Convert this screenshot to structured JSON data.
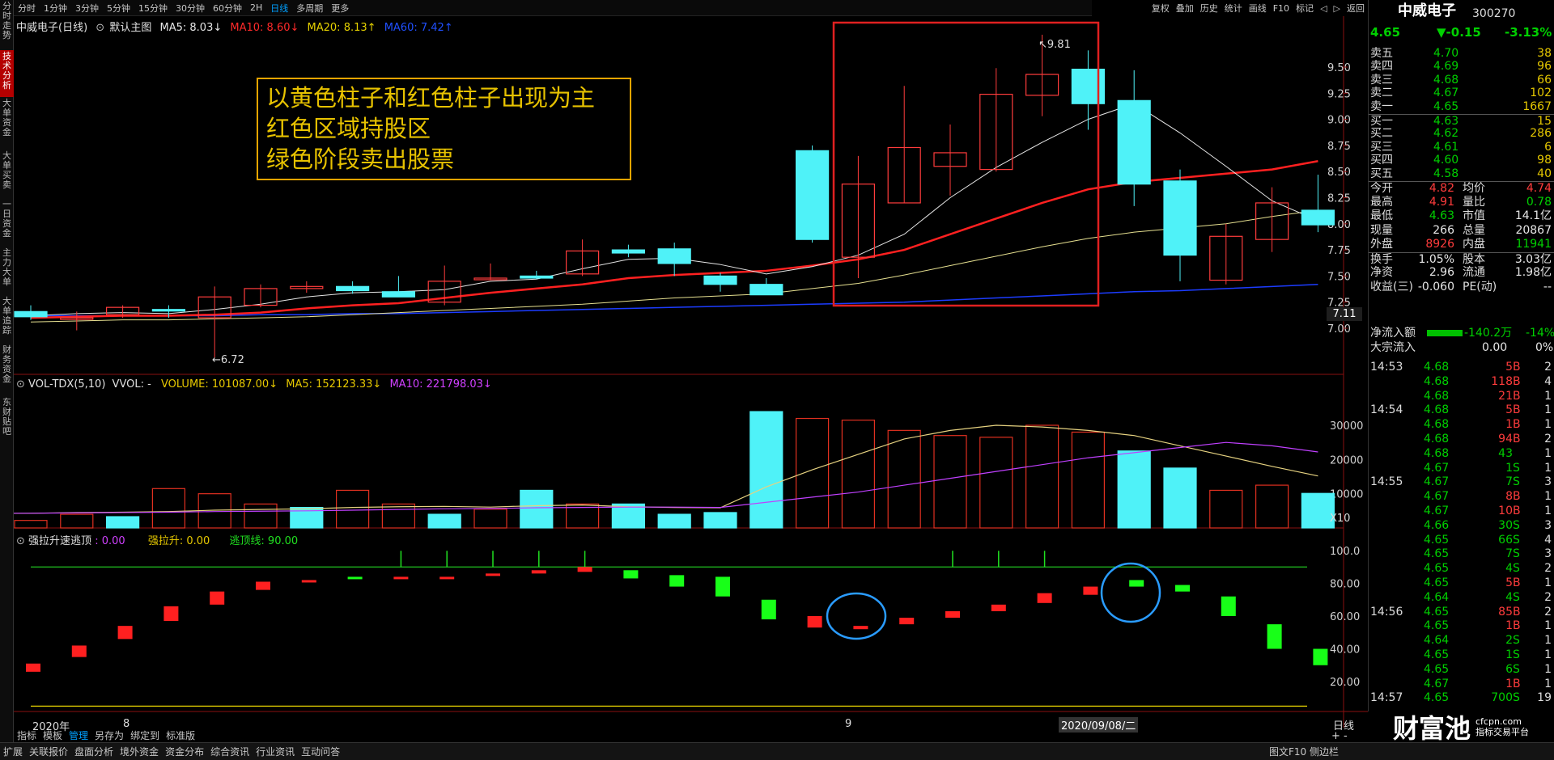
{
  "left_tabs": [
    "分时走势",
    "技术分析",
    "大单资金",
    "大单买卖",
    "一日资金",
    "主力大单",
    "大单追踪",
    "财务资金",
    "东财贴吧"
  ],
  "period_tabs": [
    "分时",
    "1分钟",
    "3分钟",
    "5分钟",
    "15分钟",
    "30分钟",
    "60分钟",
    "2H",
    "日线",
    "多周期",
    "更多"
  ],
  "period_selected": "日线",
  "tools": [
    "复权",
    "叠加",
    "历史",
    "统计",
    "画线",
    "F10",
    "标记",
    "◁",
    "▷",
    "返回"
  ],
  "main": {
    "title": "中威电子(日线)",
    "template": "默认主图",
    "ma5": "MA5: 8.03↓",
    "ma10": "MA10: 8.60↓",
    "ma20": "MA20: 8.13↑",
    "ma60": "MA60: 7.42↑"
  },
  "annotation": {
    "line1": "以黄色柱子和红色柱子出现为主",
    "line2": "红色区域持股区",
    "line3": "绿色阶段卖出股票"
  },
  "price_labels": {
    "high": "9.81",
    "low": "6.72",
    "current_tag": "7.11"
  },
  "volume": {
    "title": "VOL-TDX(5,10)",
    "vvol": "VVOL: -",
    "volume": "VOLUME: 101087.00↓",
    "ma5": "MA5: 152123.33↓",
    "ma10": "MA10: 221798.03↓",
    "unit": "X10"
  },
  "indicator": {
    "title": "强拉升速逃顶",
    "value1": ": 0.00",
    "value2_label": "强拉升: 0.00",
    "value3_label": "逃顶线: 90.00"
  },
  "date_axis": {
    "year": "2020年",
    "m8": "8",
    "m9": "9",
    "cursor": "2020/09/08/二",
    "period": "日线"
  },
  "template_tabs": [
    "指标",
    "模板",
    "管理",
    "另存为",
    "绑定到",
    "标准版"
  ],
  "template_selected": "管理",
  "stock": {
    "name": "中威电子",
    "code": "300270",
    "price": "4.65",
    "change": "▼-0.15",
    "pct": "-3.13%"
  },
  "order_book": [
    {
      "label": "卖五",
      "price": "4.70",
      "vol": "38"
    },
    {
      "label": "卖四",
      "price": "4.69",
      "vol": "96"
    },
    {
      "label": "卖三",
      "price": "4.68",
      "vol": "66"
    },
    {
      "label": "卖二",
      "price": "4.67",
      "vol": "102"
    },
    {
      "label": "卖一",
      "price": "4.65",
      "vol": "1667"
    },
    {
      "label": "买一",
      "price": "4.63",
      "vol": "15"
    },
    {
      "label": "买二",
      "price": "4.62",
      "vol": "286"
    },
    {
      "label": "买三",
      "price": "4.61",
      "vol": "6"
    },
    {
      "label": "买四",
      "price": "4.60",
      "vol": "98"
    },
    {
      "label": "买五",
      "price": "4.58",
      "vol": "40"
    }
  ],
  "quote": [
    {
      "l1": "今开",
      "v1": "4.82",
      "l2": "均价",
      "v2": "4.74"
    },
    {
      "l1": "最高",
      "v1": "4.91",
      "l2": "量比",
      "v2": "0.78"
    },
    {
      "l1": "最低",
      "v1": "4.63",
      "l2": "市值",
      "v2": "14.1亿"
    },
    {
      "l1": "现量",
      "v1": "266",
      "l2": "总量",
      "v2": "20867"
    },
    {
      "l1": "外盘",
      "v1": "8926",
      "l2": "内盘",
      "v2": "11941"
    },
    {
      "l1": "换手",
      "v1": "1.05%",
      "l2": "股本",
      "v2": "3.03亿"
    },
    {
      "l1": "净资",
      "v1": "2.96",
      "l2": "流通",
      "v2": "1.98亿"
    },
    {
      "l1": "收益(三)",
      "v1": "-0.060",
      "l2": "PE(动)",
      "v2": "--"
    }
  ],
  "flow": {
    "net_label": "净流入额",
    "net_val": "-140.2万",
    "net_pct": "-14%",
    "big_label": "大宗流入",
    "big_val": "0.00",
    "big_pct": "0%"
  },
  "ticks": [
    {
      "t": "14:53",
      "p": "4.68",
      "v": "5",
      "s": "B",
      "n": "2"
    },
    {
      "t": "",
      "p": "4.68",
      "v": "118",
      "s": "B",
      "n": "4"
    },
    {
      "t": "",
      "p": "4.68",
      "v": "21",
      "s": "B",
      "n": "1"
    },
    {
      "t": "14:54",
      "p": "4.68",
      "v": "5",
      "s": "B",
      "n": "1"
    },
    {
      "t": "",
      "p": "4.68",
      "v": "1",
      "s": "B",
      "n": "1"
    },
    {
      "t": "",
      "p": "4.68",
      "v": "94",
      "s": "B",
      "n": "2"
    },
    {
      "t": "",
      "p": "4.68",
      "v": "43",
      "s": "",
      "n": "1"
    },
    {
      "t": "",
      "p": "4.67",
      "v": "1",
      "s": "S",
      "n": "1"
    },
    {
      "t": "14:55",
      "p": "4.67",
      "v": "7",
      "s": "S",
      "n": "3"
    },
    {
      "t": "",
      "p": "4.67",
      "v": "8",
      "s": "B",
      "n": "1"
    },
    {
      "t": "",
      "p": "4.67",
      "v": "10",
      "s": "B",
      "n": "1"
    },
    {
      "t": "",
      "p": "4.66",
      "v": "30",
      "s": "S",
      "n": "3"
    },
    {
      "t": "",
      "p": "4.65",
      "v": "66",
      "s": "S",
      "n": "4"
    },
    {
      "t": "",
      "p": "4.65",
      "v": "7",
      "s": "S",
      "n": "3"
    },
    {
      "t": "",
      "p": "4.65",
      "v": "4",
      "s": "S",
      "n": "2"
    },
    {
      "t": "",
      "p": "4.65",
      "v": "5",
      "s": "B",
      "n": "1"
    },
    {
      "t": "",
      "p": "4.64",
      "v": "4",
      "s": "S",
      "n": "2"
    },
    {
      "t": "14:56",
      "p": "4.65",
      "v": "85",
      "s": "B",
      "n": "2"
    },
    {
      "t": "",
      "p": "4.65",
      "v": "1",
      "s": "B",
      "n": "1"
    },
    {
      "t": "",
      "p": "4.64",
      "v": "2",
      "s": "S",
      "n": "1"
    },
    {
      "t": "",
      "p": "4.65",
      "v": "1",
      "s": "S",
      "n": "1"
    },
    {
      "t": "",
      "p": "4.65",
      "v": "6",
      "s": "S",
      "n": "1"
    },
    {
      "t": "",
      "p": "4.67",
      "v": "1",
      "s": "B",
      "n": "1"
    },
    {
      "t": "14:57",
      "p": "4.65",
      "v": "700",
      "s": "S",
      "n": "19"
    }
  ],
  "bottom_tabs": [
    "扩展",
    "关联报价",
    "盘面分析",
    "境外资金",
    "资金分布",
    "综合资讯",
    "行业资讯",
    "互动问答"
  ],
  "bottom_right": "图文F10 侧边栏",
  "logo": {
    "main": "财富池",
    "sub1": "cfcpn.com",
    "sub2": "指标交易平台"
  },
  "chart_data": [
    {
      "type": "candlestick",
      "title": "中威电子(日线)",
      "y_ticks": [
        "9.50",
        "9.25",
        "9.00",
        "8.75",
        "8.50",
        "8.25",
        "8.00",
        "7.75",
        "7.50",
        "7.25",
        "7.00"
      ],
      "ylim": [
        6.72,
        9.85
      ],
      "ohlc": [
        [
          7.16,
          7.22,
          7.08,
          7.11
        ],
        [
          7.1,
          7.16,
          6.98,
          7.1
        ],
        [
          7.13,
          7.22,
          7.1,
          7.2
        ],
        [
          7.18,
          7.22,
          7.1,
          7.17
        ],
        [
          7.1,
          7.4,
          6.72,
          7.3
        ],
        [
          7.22,
          7.42,
          7.2,
          7.38
        ],
        [
          7.38,
          7.45,
          7.34,
          7.4
        ],
        [
          7.4,
          7.45,
          7.33,
          7.36
        ],
        [
          7.35,
          7.5,
          7.33,
          7.3
        ],
        [
          7.25,
          7.6,
          7.22,
          7.45
        ],
        [
          7.48,
          7.62,
          7.46,
          7.48
        ],
        [
          7.5,
          7.55,
          7.47,
          7.48
        ],
        [
          7.52,
          7.85,
          7.5,
          7.74
        ],
        [
          7.75,
          7.8,
          7.68,
          7.72
        ],
        [
          7.76,
          7.82,
          7.5,
          7.62
        ],
        [
          7.5,
          7.53,
          7.35,
          7.42
        ],
        [
          7.42,
          7.48,
          7.35,
          7.32
        ],
        [
          8.7,
          8.75,
          7.82,
          7.85
        ],
        [
          7.68,
          8.65,
          7.48,
          8.38
        ],
        [
          8.2,
          9.32,
          8.2,
          8.73
        ],
        [
          8.55,
          8.95,
          8.27,
          8.68
        ],
        [
          8.52,
          9.49,
          8.5,
          9.24
        ],
        [
          9.23,
          9.81,
          9.03,
          9.43
        ],
        [
          9.48,
          9.66,
          8.9,
          9.15
        ],
        [
          9.18,
          9.47,
          8.17,
          8.38
        ],
        [
          8.41,
          8.52,
          7.45,
          7.7
        ],
        [
          7.46,
          8.0,
          7.42,
          7.88
        ],
        [
          7.85,
          8.35,
          7.73,
          8.2
        ],
        [
          8.13,
          8.47,
          7.92,
          7.99
        ]
      ],
      "ma5": [
        7.12,
        7.14,
        7.15,
        7.14,
        7.18,
        7.23,
        7.3,
        7.34,
        7.35,
        7.37,
        7.45,
        7.47,
        7.57,
        7.66,
        7.67,
        7.61,
        7.52,
        7.59,
        7.7,
        7.9,
        8.25,
        8.54,
        8.78,
        9.0,
        9.15,
        8.87,
        8.55,
        8.22,
        8.03
      ],
      "ma10": [
        7.1,
        7.11,
        7.12,
        7.12,
        7.13,
        7.15,
        7.19,
        7.22,
        7.24,
        7.29,
        7.34,
        7.38,
        7.42,
        7.48,
        7.51,
        7.53,
        7.55,
        7.6,
        7.66,
        7.75,
        7.9,
        8.05,
        8.2,
        8.33,
        8.4,
        8.44,
        8.48,
        8.52,
        8.6
      ],
      "ma20": [
        7.06,
        7.07,
        7.08,
        7.08,
        7.09,
        7.1,
        7.11,
        7.13,
        7.15,
        7.17,
        7.19,
        7.21,
        7.23,
        7.26,
        7.29,
        7.31,
        7.33,
        7.38,
        7.43,
        7.51,
        7.6,
        7.69,
        7.78,
        7.86,
        7.92,
        7.96,
        8.0,
        8.07,
        8.13
      ],
      "ma60": [
        7.12,
        7.12,
        7.12,
        7.12,
        7.12,
        7.13,
        7.13,
        7.14,
        7.14,
        7.15,
        7.16,
        7.17,
        7.18,
        7.19,
        7.2,
        7.21,
        7.22,
        7.23,
        7.24,
        7.25,
        7.27,
        7.29,
        7.31,
        7.33,
        7.35,
        7.36,
        7.38,
        7.4,
        7.42
      ]
    },
    {
      "type": "bar",
      "title": "VOL-TDX(5,10)",
      "y_ticks": [
        "30000",
        "20000",
        "10000"
      ],
      "ylim": [
        0,
        36000
      ],
      "values": [
        3000,
        2200,
        4000,
        3300,
        11500,
        10000,
        7000,
        6000,
        11000,
        7000,
        4000,
        5500,
        11000,
        7000,
        7000,
        4000,
        4500,
        34000,
        32000,
        31500,
        28500,
        27000,
        26500,
        30000,
        28000,
        22500,
        17500,
        11000,
        12500,
        10100
      ],
      "ma5": [
        4200,
        4300,
        4500,
        4600,
        4800,
        5200,
        5400,
        5600,
        6000,
        6200,
        6300,
        6100,
        6500,
        6700,
        6200,
        6000,
        5900,
        12000,
        17000,
        21500,
        26000,
        28500,
        30000,
        29500,
        28500,
        27000,
        24000,
        21000,
        18000,
        15200
      ],
      "ma10": [
        4300,
        4300,
        4400,
        4500,
        4600,
        4800,
        4900,
        5000,
        5200,
        5400,
        5600,
        5700,
        5900,
        6000,
        6100,
        6100,
        6000,
        7500,
        9000,
        10500,
        12500,
        14500,
        16500,
        18500,
        20500,
        22000,
        23500,
        25000,
        24000,
        22200
      ]
    },
    {
      "type": "bar",
      "title": "强拉升速逃顶",
      "y_ticks": [
        "100.0",
        "80.00",
        "60.00",
        "40.00",
        "20.00"
      ],
      "ylim": [
        0,
        110
      ],
      "low": [
        20,
        26,
        35,
        46,
        57,
        67,
        76,
        81,
        83,
        84,
        83,
        85,
        86,
        87,
        83,
        78,
        72,
        58,
        53,
        52,
        55,
        59,
        63,
        68,
        73,
        78,
        75,
        60,
        40,
        30
      ],
      "high": [
        26,
        31,
        42,
        54,
        66,
        75,
        81,
        82,
        84,
        84,
        84,
        86,
        88,
        90,
        88,
        85,
        84,
        70,
        60,
        54,
        59,
        63,
        67,
        74,
        78,
        82,
        79,
        72,
        55,
        40
      ],
      "color": [
        "#ff2020",
        "#ff2020",
        "#ff2020",
        "#ff2020",
        "#ff2020",
        "#ff2020",
        "#ff2020",
        "#ff2020",
        "#18ff18",
        "#ff2020",
        "#ff2020",
        "#ff2020",
        "#ff2020",
        "#ff2020",
        "#18ff18",
        "#18ff18",
        "#18ff18",
        "#18ff18",
        "#ff2020",
        "#ff2020",
        "#ff2020",
        "#ff2020",
        "#ff2020",
        "#ff2020",
        "#ff2020",
        "#18ff18",
        "#18ff18",
        "#18ff18",
        "#18ff18",
        "#18ff18"
      ],
      "signal_lines": [
        90,
        5
      ],
      "spikes": [
        9,
        10,
        11,
        12,
        13,
        21,
        22,
        23
      ]
    }
  ]
}
